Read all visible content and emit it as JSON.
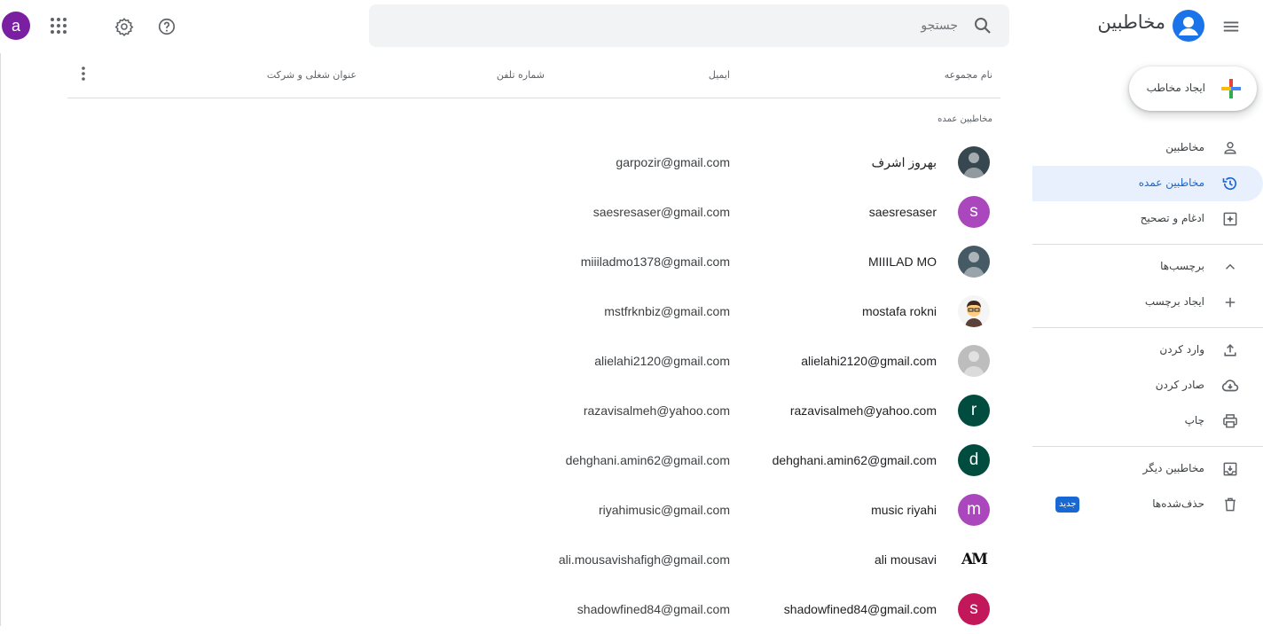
{
  "header": {
    "app_title": "مخاطبین",
    "search_placeholder": "جستجو",
    "avatar_letter": "a"
  },
  "sidebar": {
    "create_label": "ایجاد مخاطب",
    "items": [
      {
        "label": "مخاطبین",
        "icon": "person-icon"
      },
      {
        "label": "مخاطبین عمده",
        "icon": "history-icon",
        "active": true
      },
      {
        "label": "ادغام و تصحیح",
        "icon": "merge-fix-icon"
      }
    ],
    "labels_header": "برچسب‌ها",
    "create_label_item": "ایجاد برچسب",
    "tools": [
      {
        "label": "وارد کردن",
        "icon": "upload-icon"
      },
      {
        "label": "صادر کردن",
        "icon": "cloud-download-icon"
      },
      {
        "label": "چاپ",
        "icon": "print-icon"
      }
    ],
    "other_contacts": "مخاطبین دیگر",
    "trash": "حذف‌شده‌ها",
    "new_badge": "جدید"
  },
  "table": {
    "columns": {
      "name": "نام مجموعه",
      "email": "ایمیل",
      "phone": "شماره تلفن",
      "job": "عنوان شغلی و شرکت"
    },
    "section_label": "مخاطبین عمده",
    "rows": [
      {
        "name": "بهروز اشرف",
        "email": "garpozir@gmail.com",
        "avatar_type": "photo",
        "avatar_color": "#37474f"
      },
      {
        "name": "saesresaser",
        "email": "saesresaser@gmail.com",
        "avatar_letter": "s",
        "avatar_color": "#ab47bc"
      },
      {
        "name": "MIIILAD MO",
        "email": "miiiladmo1378@gmail.com",
        "avatar_type": "photo",
        "avatar_color": "#455a64"
      },
      {
        "name": "mostafa rokni",
        "email": "mstfrknbiz@gmail.com",
        "avatar_type": "cartoon",
        "avatar_color": "#8d6e63"
      },
      {
        "name": "alielahi2120@gmail.com",
        "email": "alielahi2120@gmail.com",
        "avatar_type": "photo",
        "avatar_color": "#bdbdbd"
      },
      {
        "name": "razavisalmeh@yahoo.com",
        "email": "razavisalmeh@yahoo.com",
        "avatar_letter": "r",
        "avatar_color": "#004d40"
      },
      {
        "name": "dehghani.amin62@gmail.com",
        "email": "dehghani.amin62@gmail.com",
        "avatar_letter": "d",
        "avatar_color": "#004d40"
      },
      {
        "name": "music riyahi",
        "email": "riyahimusic@gmail.com",
        "avatar_letter": "m",
        "avatar_color": "#ab47bc"
      },
      {
        "name": "ali mousavi",
        "email": "ali.mousavishafigh@gmail.com",
        "avatar_type": "logo",
        "avatar_letter": "AM",
        "avatar_color": "#ffffff"
      },
      {
        "name": "shadowfined84@gmail.com",
        "email": "shadowfined84@gmail.com",
        "avatar_letter": "s",
        "avatar_color": "#c2185b"
      }
    ]
  },
  "colors": {
    "accent": "#1a73e8",
    "active_bg": "#e8f0fe",
    "active_text": "#1967d2"
  }
}
